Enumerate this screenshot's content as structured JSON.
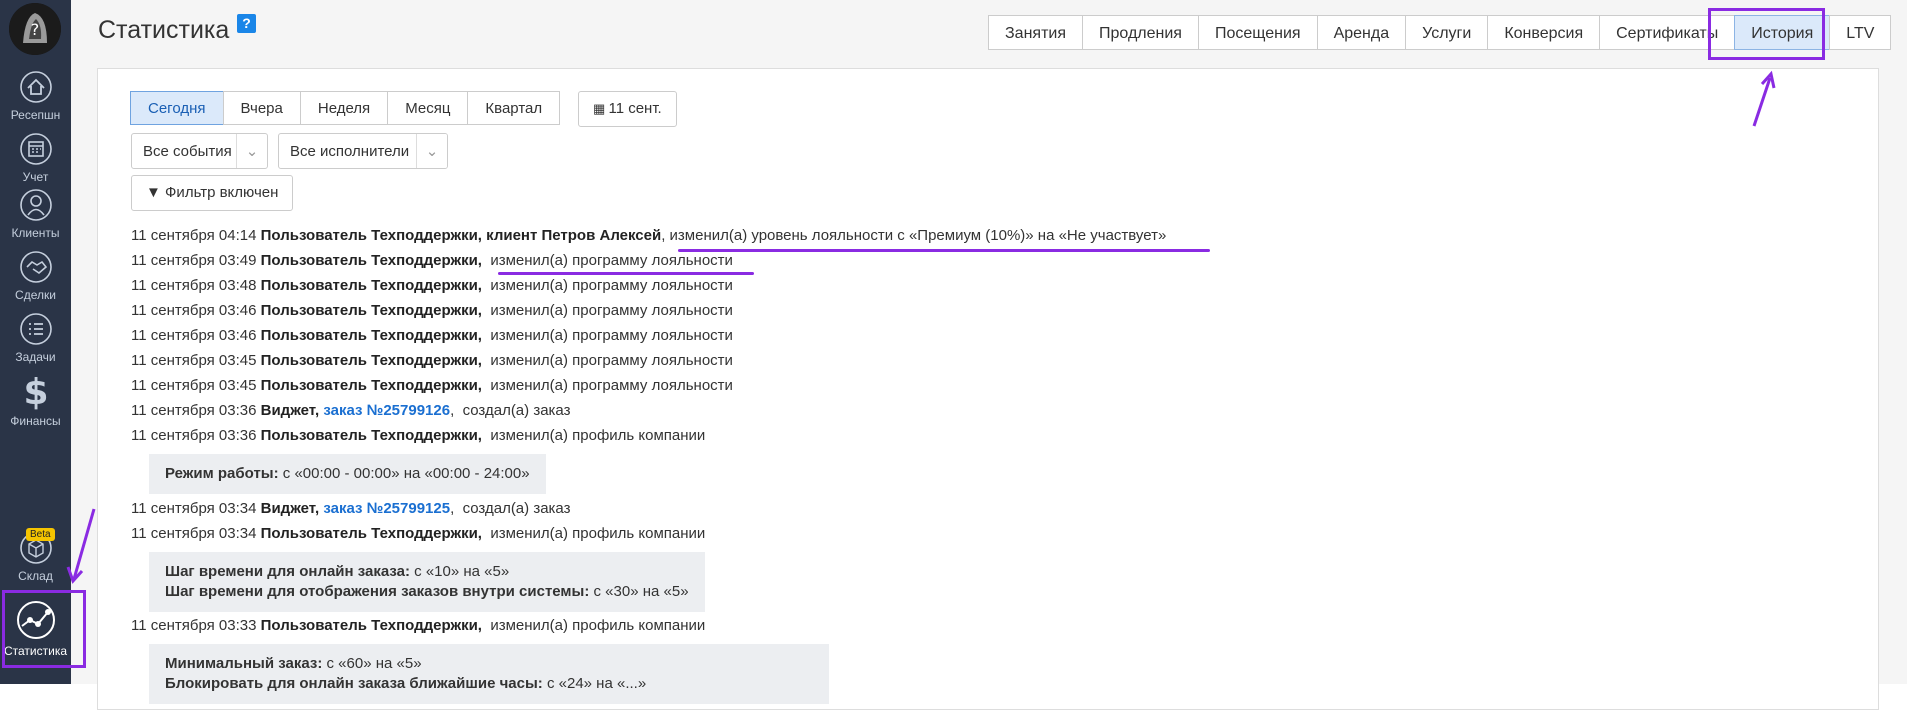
{
  "sidebar": {
    "items": [
      {
        "label": "Ресепшн",
        "icon": "home-icon"
      },
      {
        "label": "Учет",
        "icon": "calendar-icon"
      },
      {
        "label": "Клиенты",
        "icon": "user-icon"
      },
      {
        "label": "Сделки",
        "icon": "handshake-icon"
      },
      {
        "label": "Задачи",
        "icon": "tasks-icon"
      },
      {
        "label": "Финансы",
        "icon": "dollar-icon"
      },
      {
        "label": "Склад",
        "icon": "box-icon",
        "badge": "Beta"
      },
      {
        "label": "Статистика",
        "icon": "chart-icon"
      }
    ]
  },
  "header": {
    "title": "Статистика",
    "help": "?"
  },
  "tabs": [
    "Занятия",
    "Продления",
    "Посещения",
    "Аренда",
    "Услуги",
    "Конверсия",
    "Сертификаты",
    "История",
    "LTV"
  ],
  "period": [
    "Сегодня",
    "Вчера",
    "Неделя",
    "Месяц",
    "Квартал"
  ],
  "date_button": "11 сент.",
  "filters": {
    "events": "Все события",
    "performers": "Все исполнители",
    "filter_label": "Фильтр включен"
  },
  "log": [
    {
      "time": "11 сентября 04:14",
      "who": "Пользователь Техподдержки, клиент Петров Алексей",
      "action": ", изменил(а) уровень лояльности с «Премиум (10%)» на «Не участвует»"
    },
    {
      "time": "11 сентября 03:49",
      "who": "Пользователь Техподдержки,",
      "action": "изменил(а) программу лояльности"
    },
    {
      "time": "11 сентября 03:48",
      "who": "Пользователь Техподдержки,",
      "action": "изменил(а) программу лояльности"
    },
    {
      "time": "11 сентября 03:46",
      "who": "Пользователь Техподдержки,",
      "action": "изменил(а) программу лояльности"
    },
    {
      "time": "11 сентября 03:46",
      "who": "Пользователь Техподдержки,",
      "action": "изменил(а) программу лояльности"
    },
    {
      "time": "11 сентября 03:45",
      "who": "Пользователь Техподдержки,",
      "action": "изменил(а) программу лояльности"
    },
    {
      "time": "11 сентября 03:45",
      "who": "Пользователь Техподдержки,",
      "action": "изменил(а) программу лояльности"
    },
    {
      "time": "11 сентября 03:36",
      "who": "Виджет,",
      "link": "заказ №25799126",
      "action": "создал(а) заказ"
    },
    {
      "time": "11 сентября 03:36",
      "who": "Пользователь Техподдержки,",
      "action": "изменил(а) профиль компании"
    },
    {
      "time": "11 сентября 03:34",
      "who": "Виджет,",
      "link": "заказ №25799125",
      "action": "создал(а) заказ"
    },
    {
      "time": "11 сентября 03:34",
      "who": "Пользователь Техподдержки,",
      "action": "изменил(а) профиль компании"
    },
    {
      "time": "11 сентября 03:33",
      "who": "Пользователь Техподдержки,",
      "action": "изменил(а) профиль компании"
    }
  ],
  "details": [
    [
      {
        "key": "Режим работы:",
        "val": " с «00:00 - 00:00» на «00:00 - 24:00»"
      }
    ],
    [
      {
        "key": "Шаг времени для онлайн заказа:",
        "val": " с «10» на «5»"
      },
      {
        "key": "Шаг времени для отображения заказов внутри системы:",
        "val": " с «30» на «5»"
      }
    ],
    [
      {
        "key": "Минимальный заказ:",
        "val": " с «60» на «5»"
      },
      {
        "key": "Блокировать для онлайн заказа ближайшие часы:",
        "val": " с «24» на «...»"
      }
    ]
  ]
}
